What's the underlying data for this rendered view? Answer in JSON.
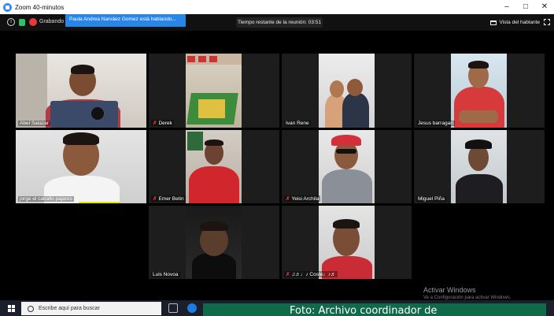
{
  "window": {
    "title": "Zoom 40-minutos",
    "controls": [
      "–",
      "□",
      "✕"
    ]
  },
  "toolbar": {
    "recording_label": "Grabando",
    "speaker_banner": "Paula Andrea Narváez Gomez está hablando...",
    "timer": "Tiempo restante de la reunión: 03:51",
    "view_label": "Vista del hablante"
  },
  "participants": [
    {
      "name": "Abel Salazar",
      "muted": false
    },
    {
      "name": "Derek",
      "muted": true
    },
    {
      "name": "Ivan Rene",
      "muted": false
    },
    {
      "name": "Jesus barragan",
      "muted": false
    },
    {
      "name": "jorge el caballo pajares",
      "muted": false
    },
    {
      "name": "Emer Betin",
      "muted": true
    },
    {
      "name": "Yeisi Archila",
      "muted": true
    },
    {
      "name": "Miguel Piña",
      "muted": false
    },
    {
      "name": "Luis Novoa",
      "muted": false
    },
    {
      "name": "♫♬♩♪ Coste♩♪♬",
      "muted": true
    }
  ],
  "taskbar": {
    "search_placeholder": "Escribe aquí para buscar"
  },
  "watermark": {
    "title": "Activar Windows",
    "subtitle": "Ve a Configuración para activar Windows."
  },
  "caption": "Foto: Archivo coordinador de"
}
